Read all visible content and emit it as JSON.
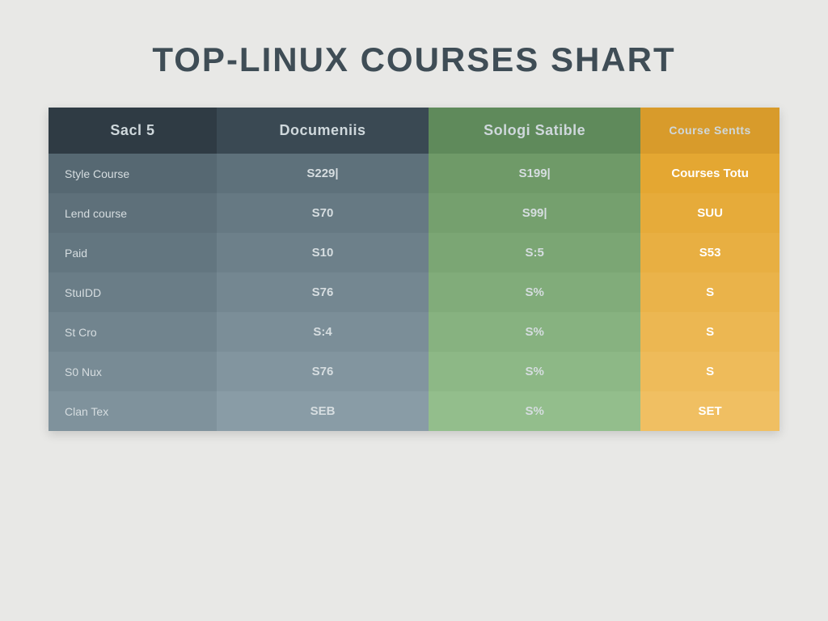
{
  "chart_data": {
    "type": "table",
    "title": "TOP-LINUX COURSES SHART",
    "columns": [
      "Sacl 5",
      "Documeniis",
      "Sologi Satible",
      "Course Sentts"
    ],
    "rows": [
      {
        "label": "Style Course",
        "values": [
          "S229|",
          "S199|",
          "Courses Totu"
        ]
      },
      {
        "label": "Lend course",
        "values": [
          "S70",
          "S99|",
          "SUU"
        ]
      },
      {
        "label": "Paid",
        "values": [
          "S10",
          "S:5",
          "S53"
        ]
      },
      {
        "label": "StuIDD",
        "values": [
          "S76",
          "S%",
          "S"
        ]
      },
      {
        "label": "St Cro",
        "values": [
          "S:4",
          "S%",
          "S"
        ]
      },
      {
        "label": "S0 Nux",
        "values": [
          "S76",
          "S%",
          "S"
        ]
      },
      {
        "label": "Clan Tex",
        "values": [
          "SEB",
          "S%",
          "SET"
        ]
      }
    ]
  }
}
